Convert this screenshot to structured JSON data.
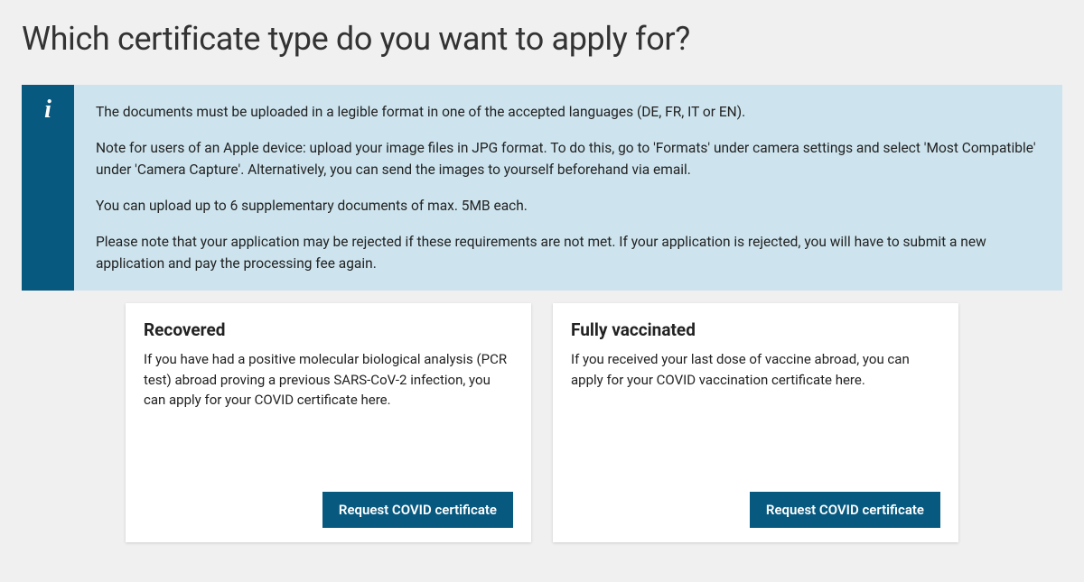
{
  "page": {
    "title": "Which certificate type do you want to apply for?"
  },
  "info": {
    "icon_label": "i",
    "paragraphs": [
      "The documents must be uploaded in a legible format in one of the accepted languages (DE, FR, IT or EN).",
      "Note for users of an Apple device: upload your image files in JPG format. To do this, go to 'Formats' under camera settings and select 'Most Compatible' under 'Camera Capture'. Alternatively, you can send the images to yourself beforehand via email.",
      "You can upload up to 6 supplementary documents of max. 5MB each.",
      "Please note that your application may be rejected if these requirements are not met. If your application is rejected, you will have to submit a new application and pay the processing fee again."
    ]
  },
  "cards": [
    {
      "title": "Recovered",
      "description": "If you have had a positive molecular biological analysis (PCR test) abroad proving a previous SARS-CoV-2 infection, you can apply for your COVID certificate here.",
      "button_label": "Request COVID certificate"
    },
    {
      "title": "Fully vaccinated",
      "description": "If you received your last dose of vaccine abroad, you can apply for your COVID vaccination certificate here.",
      "button_label": "Request COVID certificate"
    }
  ]
}
